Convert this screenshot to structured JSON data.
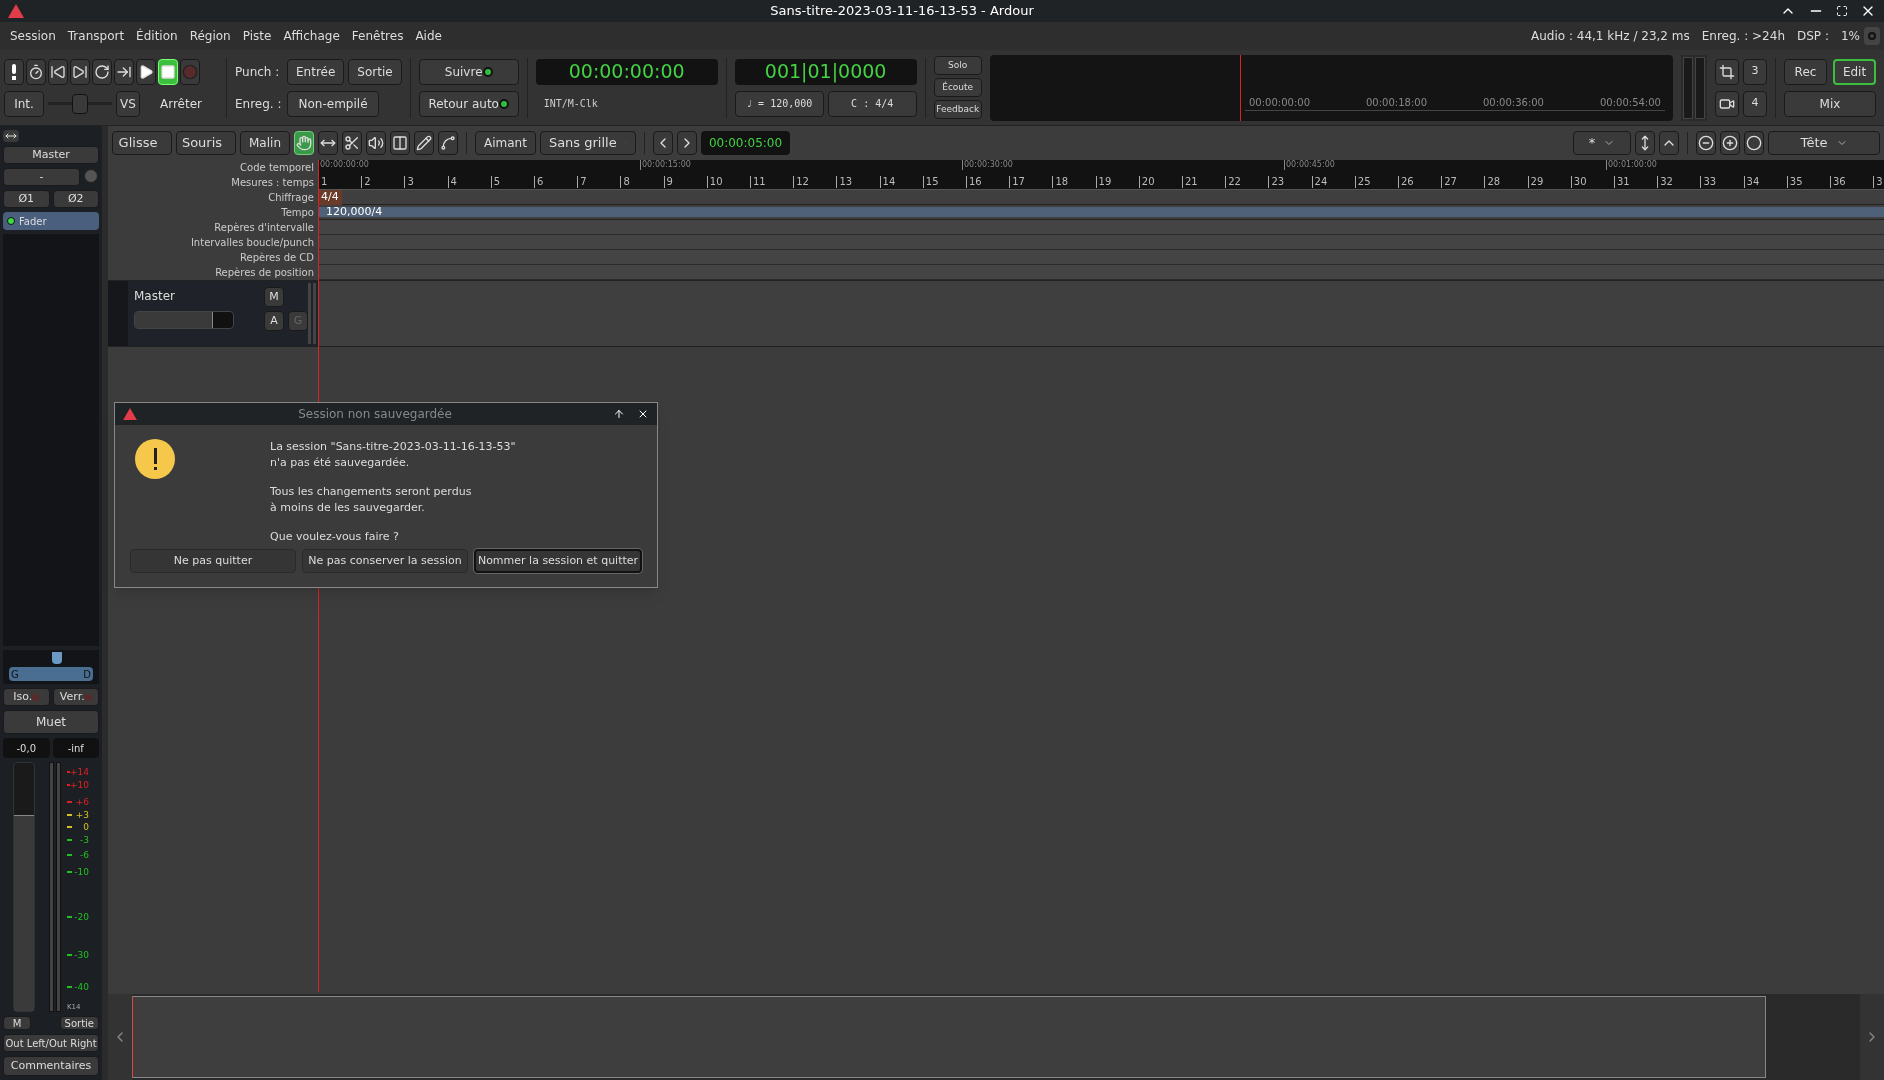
{
  "window": {
    "title": "Sans-titre-2023-03-11-16-13-53 - Ardour"
  },
  "menu": [
    "Session",
    "Transport",
    "Édition",
    "Région",
    "Piste",
    "Affichage",
    "Fenêtres",
    "Aide"
  ],
  "status": {
    "audio": "Audio : 44,1 kHz / 23,2 ms",
    "record": "Enreg. : >24h",
    "dsp_label": "DSP :",
    "dsp_value": "1%"
  },
  "transport_buttons": [
    {
      "kind": "alert",
      "on": false
    },
    {
      "kind": "metronome",
      "on": false
    },
    {
      "kind": "start",
      "on": false
    },
    {
      "kind": "end",
      "on": false
    },
    {
      "kind": "loop",
      "on": false
    },
    {
      "kind": "range",
      "on": false
    },
    {
      "kind": "play",
      "on": false
    },
    {
      "kind": "stop",
      "on": true
    },
    {
      "kind": "record",
      "on": false
    }
  ],
  "sync_button": "Int.",
  "shuttle": {
    "level": 0.5
  },
  "vs_button": "VS",
  "shuttle_mode": "Arrêter",
  "punch": {
    "label": "Punch :",
    "buttons": [
      "Entrée",
      "Sortie"
    ]
  },
  "record_mode": {
    "label": "Enreg. :",
    "value": "Non-empilé"
  },
  "toggles": [
    {
      "label": "Suivre",
      "on": true
    },
    {
      "label": "Retour auto",
      "on": true
    }
  ],
  "clocks": {
    "primary": "00:00:00:00",
    "primary_info": "INT/M-Clk",
    "secondary": "001|01|0000",
    "tempo": "♩ = 120,000",
    "meter": "C : 4/4"
  },
  "monitor_buttons": [
    "Solo",
    "Écoute",
    "Feedback"
  ],
  "mini_timeline": [
    "00:00:00:00",
    "00:00:18:00",
    "00:00:36:00",
    "00:00:54:00"
  ],
  "layout_buttons": [
    "3",
    "4"
  ],
  "window_buttons": [
    {
      "label": "Rec",
      "selected": false
    },
    {
      "label": "Edit",
      "selected": true
    },
    {
      "label": "Mix",
      "selected": false
    }
  ],
  "edit_toolbar": {
    "edit_mode": "Glisse",
    "ripple": "Souris",
    "smart": "Malin",
    "tools": [
      {
        "kind": "grab",
        "selected": true
      },
      {
        "kind": "range",
        "selected": false
      },
      {
        "kind": "cut",
        "selected": false
      },
      {
        "kind": "audition",
        "selected": false
      },
      {
        "kind": "stretch",
        "selected": false
      },
      {
        "kind": "draw",
        "selected": false
      },
      {
        "kind": "content",
        "selected": false
      }
    ],
    "snap": "Aimant",
    "grid": "Sans grille",
    "nudge_clock": "00:00:05:00",
    "visible_tracks": "*",
    "zoom_focus": "Tête"
  },
  "rulers": {
    "labels": [
      "Code temporel",
      "Mesures : temps",
      "Chiffrage",
      "Tempo",
      "Repères d'intervalle",
      "Intervalles boucle/punch",
      "Repères de CD",
      "Repères de position"
    ],
    "timecodes": [
      "00:00:00:00",
      "00:00:15:00",
      "00:00:30:00",
      "00:00:45:00",
      "00:01:00:00"
    ],
    "bars": [
      "1",
      "2",
      "3",
      "4",
      "5",
      "6",
      "7",
      "8",
      "9",
      "10",
      "11",
      "12",
      "13",
      "14",
      "15",
      "16",
      "17",
      "18",
      "19",
      "20",
      "21",
      "22",
      "23",
      "24",
      "25",
      "26",
      "27",
      "28",
      "29",
      "30",
      "31",
      "32",
      "33",
      "34",
      "35",
      "36",
      "3"
    ],
    "meter": "4/4",
    "tempo": "120,000/4"
  },
  "track": {
    "name": "Master",
    "level": 0.8,
    "buttons": [
      {
        "label": "M",
        "disabled": false
      },
      {
        "label": "A",
        "disabled": false
      },
      {
        "label": "G",
        "disabled": true
      }
    ]
  },
  "strip": {
    "name": "Master",
    "input": "-",
    "phase": [
      "Ø1",
      "Ø2"
    ],
    "plugins": [
      {
        "name": "Fader",
        "active": true
      }
    ],
    "pan_left": "G",
    "pan_right": "D",
    "iso": "Iso.",
    "lock": "Verr.",
    "mute": "Muet",
    "gain": "-0,0",
    "peak": "-inf",
    "fader": {
      "level": 0.79
    },
    "scale": [
      {
        "label": "+14",
        "color": "#e02020"
      },
      {
        "label": "+10",
        "color": "#e02020"
      },
      {
        "label": "+6",
        "color": "#e02020"
      },
      {
        "label": "+3",
        "color": "#d4c020"
      },
      {
        "label": "0",
        "color": "#d4c020"
      },
      {
        "label": "-3",
        "color": "#20c020"
      },
      {
        "label": "-6",
        "color": "#20c020"
      },
      {
        "label": "-10",
        "color": "#20c020"
      },
      {
        "label": "-20",
        "color": "#20c020"
      },
      {
        "label": "-30",
        "color": "#20c020"
      },
      {
        "label": "-40",
        "color": "#20c020"
      }
    ],
    "meter_type": "K14",
    "meter_point": "M",
    "output_label": "Sortie",
    "output": "Out Left/Out Right",
    "comments": "Commentaires"
  },
  "dialog": {
    "title": "Session non sauvegardée",
    "paragraphs": [
      "La session \"Sans-titre-2023-03-11-16-13-53\"\nn'a pas été sauvegardée.",
      "Tous les changements seront perdus\nà moins de les sauvegarder.",
      "Que voulez-vous faire ?"
    ],
    "buttons": [
      {
        "label": "Ne pas quitter",
        "selected": false
      },
      {
        "label": "Ne pas conserver la session",
        "selected": false
      },
      {
        "label": "Nommer la session et quitter",
        "selected": true
      }
    ]
  }
}
